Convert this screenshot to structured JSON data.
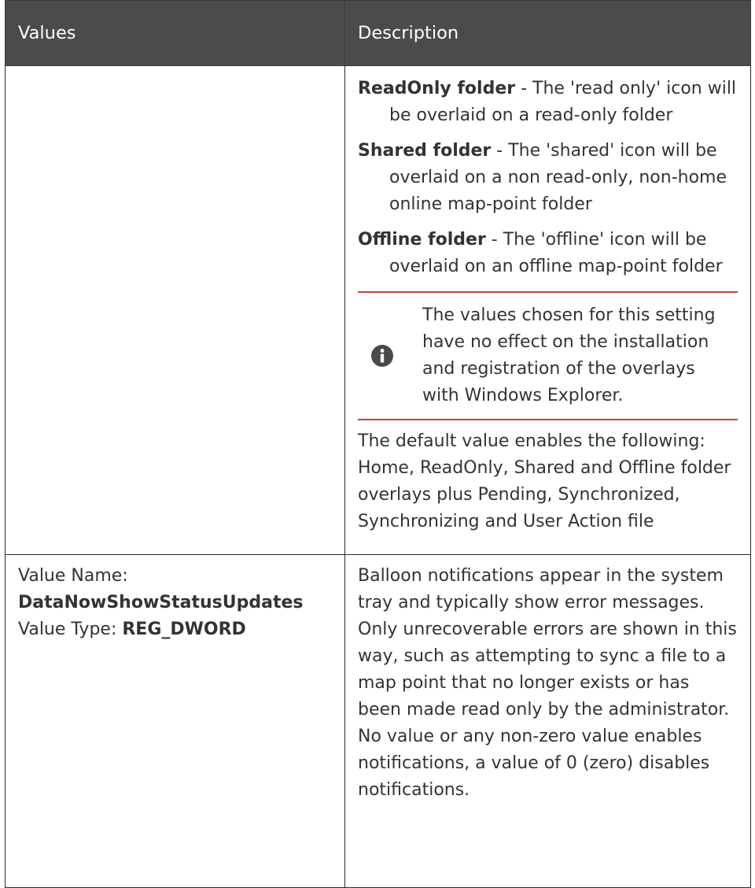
{
  "table": {
    "headers": {
      "values": "Values",
      "description": "Description"
    },
    "row1": {
      "folders": [
        {
          "term": "ReadOnly folder",
          "desc": " - The 'read only' icon will be overlaid on a read-only folder"
        },
        {
          "term": "Shared folder",
          "desc": " - The 'shared' icon will be overlaid on a non read-only, non-home online map-point folder"
        },
        {
          "term": "Offline folder",
          "desc": " - The 'offline' icon will be overlaid on an offline map-point folder"
        }
      ],
      "note": {
        "icon": "info-icon",
        "text": "The values chosen for this setting have no effect on the installation and registration of the overlays with Windows Explorer."
      },
      "default_text": "The default value enables the following: Home, ReadOnly, Shared and Offline folder overlays plus Pending, Synchronized, Synchronizing and User Action file"
    },
    "row2": {
      "value_name_label": "Value Name:",
      "value_name": "DataNowShowStatusUpdates",
      "value_type_label": "Value Type: ",
      "value_type": "REG_DWORD",
      "description": "Balloon notifications appear in the system tray and typically show error messages. Only unrecoverable errors are shown in this way, such as attempting to sync a file to a map point that no longer exists or has been made read only by the administrator. No value or any non-zero value enables notifications, a value of 0 (zero) disables notifications."
    }
  },
  "colors": {
    "header_bg": "#4b4b4b",
    "note_rule": "#c0453a",
    "text": "#333333"
  }
}
